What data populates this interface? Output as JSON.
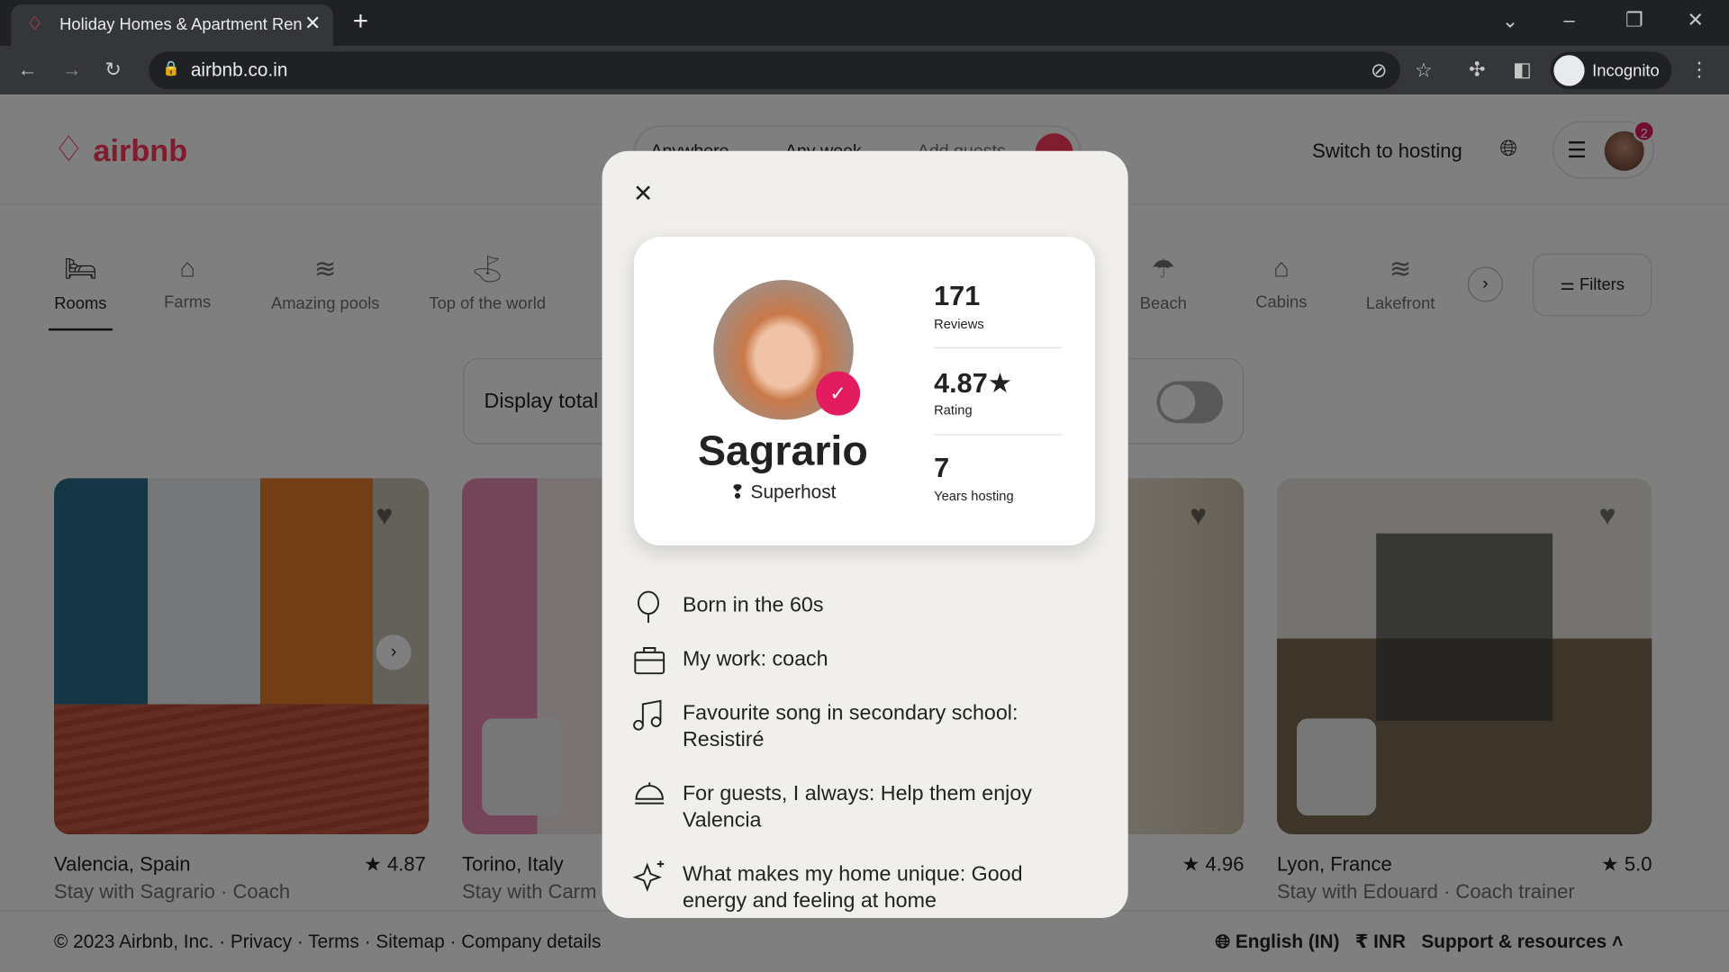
{
  "browser": {
    "tab_title": "Holiday Homes & Apartment Rentals",
    "url": "airbnb.co.in",
    "profile": "Incognito"
  },
  "header": {
    "logo": "airbnb",
    "search": [
      "Anywhere",
      "Any week",
      "Add guests"
    ],
    "switch_hosting": "Switch to hosting",
    "notifications": "2"
  },
  "categories": [
    {
      "label": "Rooms",
      "active": true
    },
    {
      "label": "Farms"
    },
    {
      "label": "Amazing pools"
    },
    {
      "label": "Top of the world"
    },
    {
      "label": "Beach"
    },
    {
      "label": "Cabins"
    },
    {
      "label": "Lakefront"
    }
  ],
  "filters": "Filters",
  "display_total": "Display total",
  "listings": [
    {
      "title": "Valencia, Spain",
      "rating": "4.87",
      "subtitle": "Stay with Sagrario · Coach"
    },
    {
      "title": "Torino, Italy",
      "subtitle": "Stay with Carm"
    },
    {
      "rating": "4.96"
    },
    {
      "title": "Lyon, France",
      "rating": "5.0",
      "subtitle": "Stay with Edouard · Coach trainer"
    }
  ],
  "footer": {
    "copyright": "© 2023 Airbnb, Inc.",
    "links": [
      "Privacy",
      "Terms",
      "Sitemap",
      "Company details"
    ],
    "language": "English (IN)",
    "currency": "₹  INR",
    "support": "Support & resources"
  },
  "modal": {
    "name": "Sagrario",
    "badge": "Superhost",
    "stats": [
      {
        "value": "171",
        "label": "Reviews"
      },
      {
        "value": "4.87★",
        "label": "Rating"
      },
      {
        "value": "7",
        "label": "Years hosting"
      }
    ],
    "items": [
      {
        "icon": "balloon-icon",
        "text": "Born in the 60s"
      },
      {
        "icon": "briefcase-icon",
        "text": "My work: coach"
      },
      {
        "icon": "music-note-icon",
        "text": "Favourite song in secondary school: Resistiré"
      },
      {
        "icon": "service-bell-icon",
        "text": "For guests, I always: Help them enjoy Valencia"
      },
      {
        "icon": "sparkles-icon",
        "text": "What makes my home unique: Good energy and feeling at home"
      }
    ]
  },
  "colors": {
    "brand": "#ff385c",
    "badge": "#e31c5f"
  }
}
